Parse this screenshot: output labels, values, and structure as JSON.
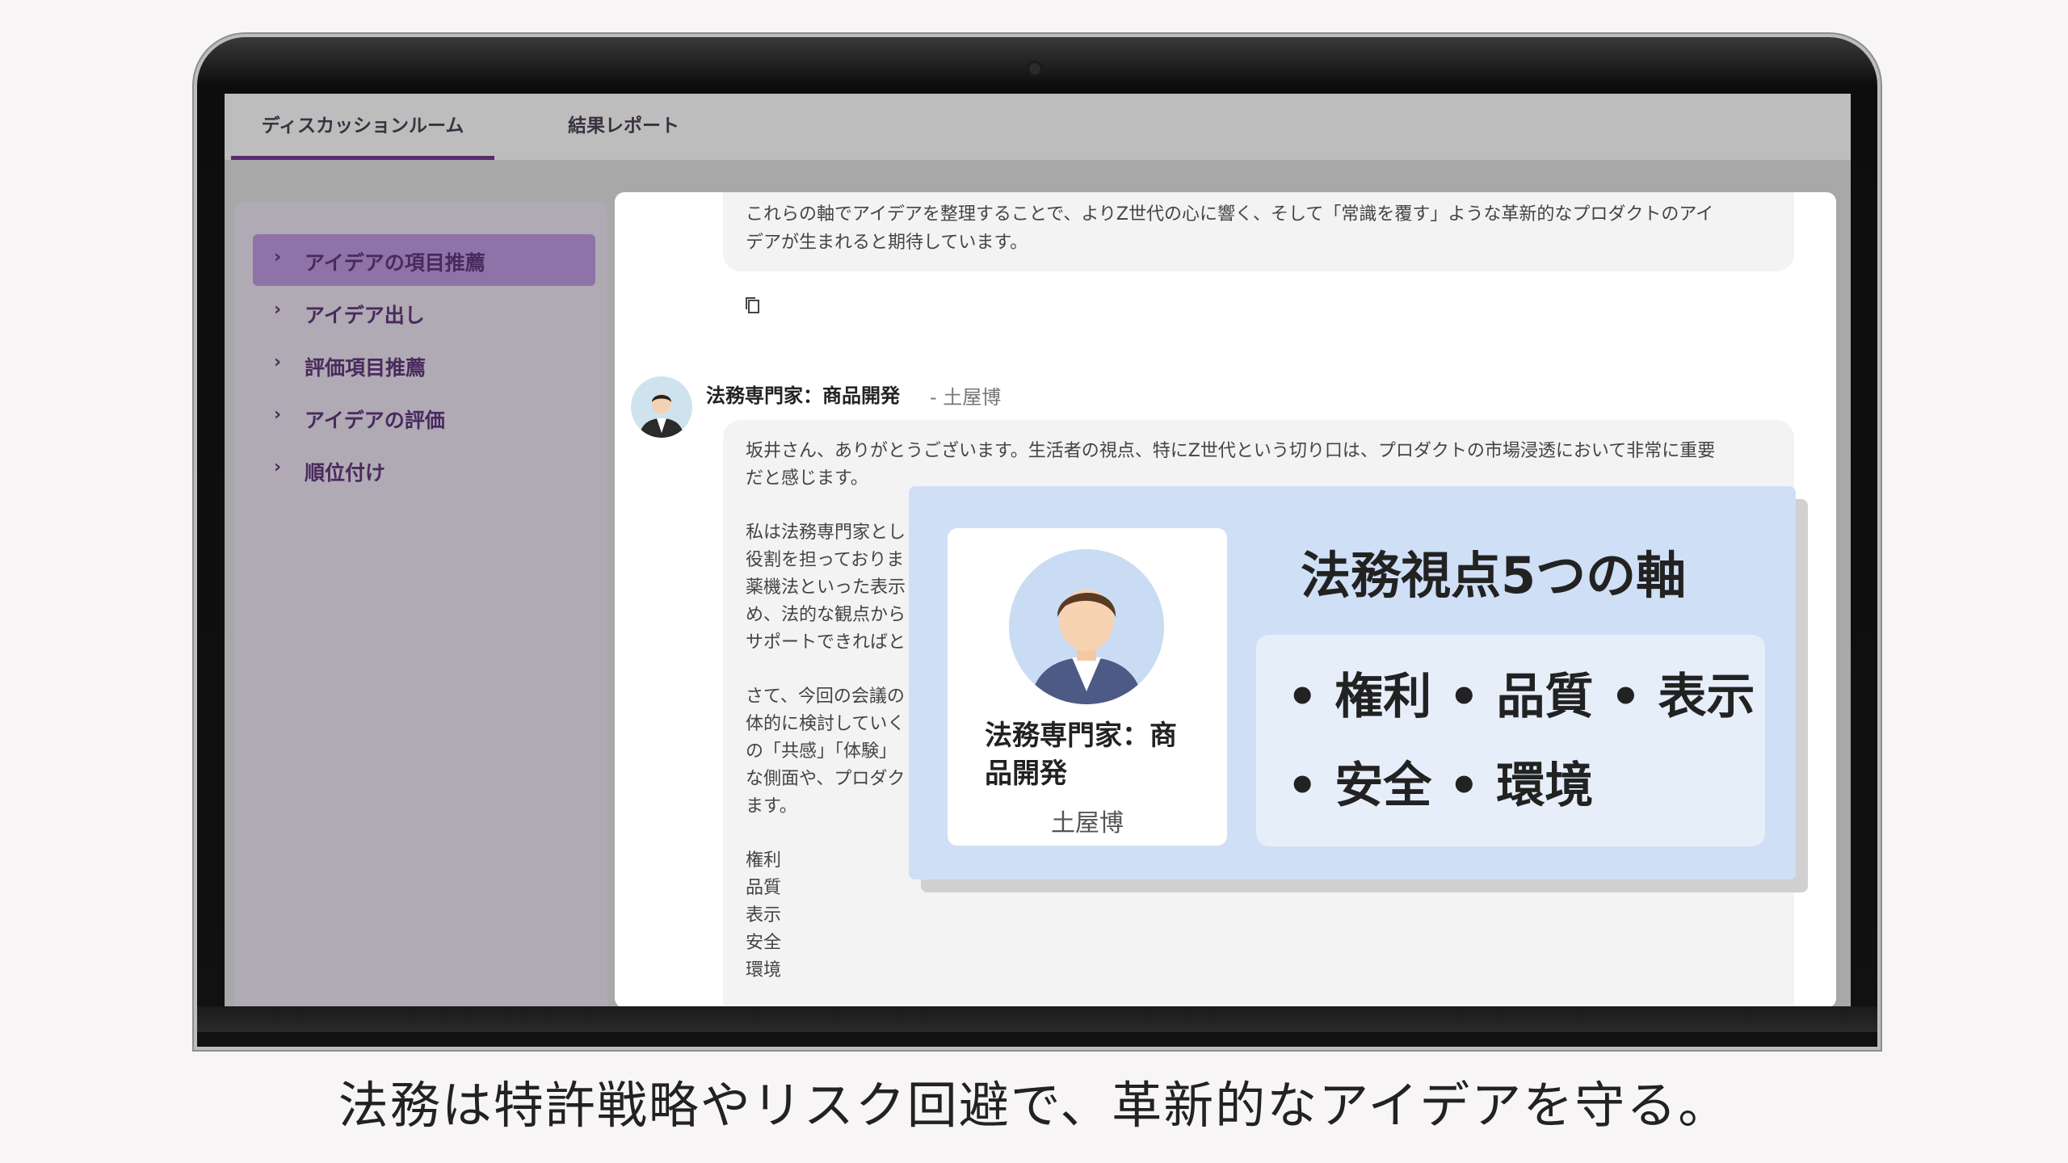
{
  "tabs": [
    {
      "label": "ディスカッションルーム",
      "active": true
    },
    {
      "label": "結果レポート",
      "active": false
    }
  ],
  "sidebar": {
    "items": [
      {
        "label": "アイデアの項目推薦",
        "active": true
      },
      {
        "label": "アイデア出し",
        "active": false
      },
      {
        "label": "評価項目推薦",
        "active": false
      },
      {
        "label": "アイデアの評価",
        "active": false
      },
      {
        "label": "順位付け",
        "active": false
      }
    ],
    "chevron": "›"
  },
  "chat": {
    "prev_message": {
      "line1": "これらの軸でアイデアを整理することで、よりZ世代の心に響く、そして「常識を覆す」ような革新的なプロダクトのアイ",
      "line2": "デアが生まれると期待しています。"
    },
    "message": {
      "sender_role": "法務専門家：商品開発",
      "sender_person": "- 土屋博",
      "para1_line1": "坂井さん、ありがとうございます。生活者の視点、特にZ世代という切り口は、プロダクトの市場浸透において非常に重要",
      "para1_line2": "だと感じます。",
      "para2": [
        "私は法務専門家とし",
        "役割を担っておりま",
        "薬機法といった表示",
        "め、法的な観点から",
        "サポートできればと"
      ],
      "para3": [
        "さて、今回の会議の",
        "体的に検討していく",
        "の「共感」「体験」",
        "な側面や、プロダク",
        "ます。"
      ],
      "axes_list": [
        "権利",
        "品質",
        "表示",
        "安全",
        "環境"
      ]
    }
  },
  "overlay": {
    "role": "法務専門家：商品開発",
    "name": "土屋博",
    "title": "法務視点5つの軸",
    "line1": "• 権利 • 品質 • 表示",
    "line2": "• 安全 • 環境"
  },
  "caption": "法務は特許戦略やリスク回避で、革新的なアイデアを守る。",
  "colors": {
    "accent": "#5a2a6e",
    "sidebar_active": "#8e73a8",
    "overlay_bg": "#cfdff5"
  }
}
